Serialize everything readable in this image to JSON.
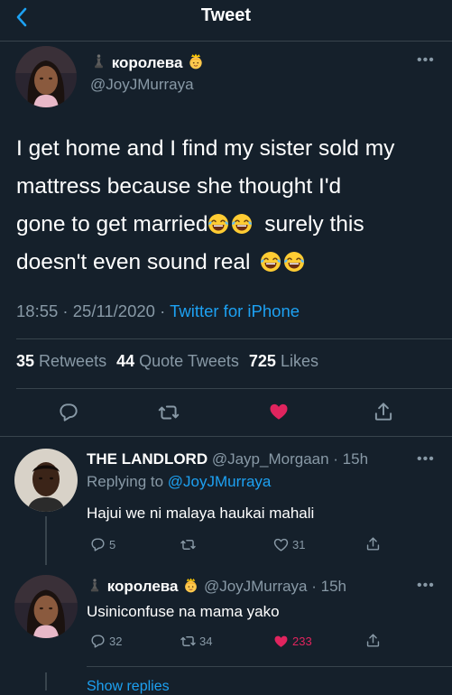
{
  "header": {
    "title": "Tweet"
  },
  "tweet": {
    "author_name": "королева",
    "author_handle": "@JoyJMurraya",
    "text_lines": [
      "I get home and I find my sister sold my",
      "mattress because she thought I'd",
      "gone to get married",
      "surely this",
      "doesn't even sound real"
    ],
    "time": "18:55 · 25/11/2020 · ",
    "source": "Twitter for iPhone",
    "retweets_count": "35",
    "retweets_label": "Retweets",
    "quotes_count": "44",
    "quotes_label": "Quote Tweets",
    "likes_count": "725",
    "likes_label": "Likes",
    "like_color": "#e0245e"
  },
  "replies": [
    {
      "name": "THE LANDLORD",
      "handle": "@Jayp_Morgaan",
      "time": "· 15h",
      "replying_label": "Replying to",
      "replying_handle": "@JoyJMurraya",
      "text": "Hajui we ni malaya haukai mahali",
      "reply_count": "5",
      "retweet_count": "",
      "like_count": "31"
    },
    {
      "name": "королева",
      "handle": "@JoyJMurraya",
      "time": "· 15h",
      "text": "Usiniconfuse na mama yako",
      "reply_count": "32",
      "retweet_count": "34",
      "like_count": "233"
    }
  ],
  "show_replies": "Show replies",
  "icons": {
    "back": "chevron-left-icon",
    "reply": "comment-icon",
    "retweet": "retweet-icon",
    "like": "heart-icon",
    "share": "share-icon",
    "more": "more-icon",
    "chess": "chess-piece-icon",
    "princess": "princess-emoji-icon",
    "laugh": "tears-of-joy-emoji-icon"
  },
  "colors": {
    "background": "#15202b",
    "accent": "#1da1f2",
    "muted": "#8899a6",
    "like": "#e0245e"
  }
}
